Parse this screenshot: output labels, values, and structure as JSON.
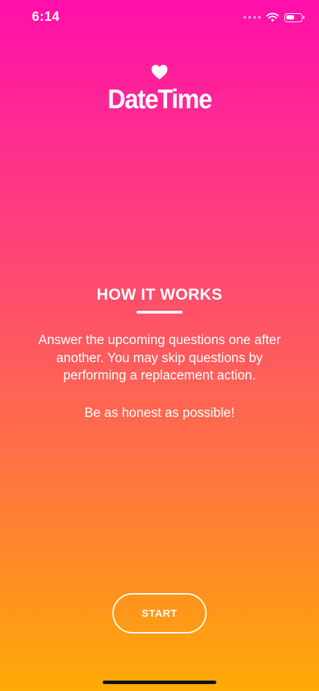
{
  "status_bar": {
    "time": "6:14",
    "signal_icon": "cellular-dots-icon",
    "wifi_icon": "wifi-icon",
    "battery_icon": "battery-icon",
    "battery_level": 0.6
  },
  "logo": {
    "icon": "heart-icon",
    "app_name": "DateTime"
  },
  "how_it_works": {
    "title": "HOW IT WORKS",
    "description": "Answer the upcoming questions one after another. You may skip questions by performing a replacement action.",
    "note": "Be as honest as possible!"
  },
  "actions": {
    "start_label": "START"
  },
  "colors": {
    "gradient_top": "#ff0fab",
    "gradient_bottom": "#ffab06",
    "text": "#ffffff"
  }
}
